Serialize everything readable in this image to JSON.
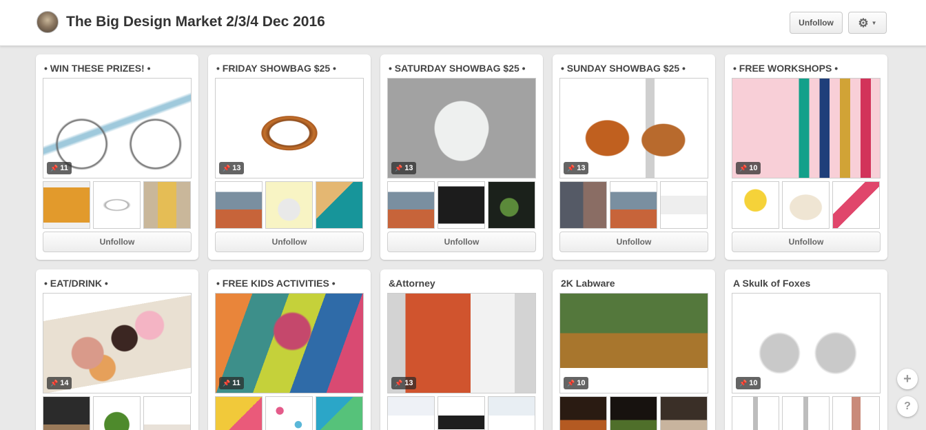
{
  "header": {
    "title": "The Big Design Market 2/3/4 Dec 2016",
    "unfollow_label": "Unfollow"
  },
  "row1": [
    {
      "title": "• WIN THESE PRIZES! •",
      "pins": "11",
      "unfollow_label": "Unfollow",
      "cover_bg": "radial-gradient(ellipse 22% 32% at 26% 66%, transparent 72%, #666 76%, transparent 82%), radial-gradient(ellipse 22% 32% at 76% 66%, transparent 72%, #666 76%, transparent 82%), linear-gradient(160deg, transparent 44%, #9fc9dc 46%, #9fc9dc 49%, transparent 51%), #ffffff",
      "thumbs": [
        "linear-gradient(#f0f0f0 0 12%, #e29a2c 12% 88%, #f0f0f0 88%)",
        "radial-gradient(ellipse 40% 18% at 50% 50%, #ffffff 55%, #a9a9a9 62%, #ffffff 76%), #ffffff",
        "linear-gradient(90deg, #c9b79a 0 30%, #e5bd55 30% 70%, #c9b79a 70%)"
      ]
    },
    {
      "title": "• FRIDAY SHOWBAG $25 •",
      "pins": "13",
      "unfollow_label": "Unfollow",
      "cover_bg": "radial-gradient(ellipse 24% 22% at 50% 55%, #ffffff 55%, #8b4a1c 58%, #c4712c 70%, #a8581f 78%, transparent 80%), #ffffff",
      "thumbs": [
        "linear-gradient(#ffffff 0 22%, #7a8fa0 22% 60%, #c7643a 60%)",
        "radial-gradient(circle at 50% 60%, #e9e9e9 0 30%, transparent 32%), #f8f4c4",
        "linear-gradient(135deg, #e4b772 0 40%, #17959a 40%)"
      ]
    },
    {
      "title": "• SATURDAY SHOWBAG $25 •",
      "pins": "13",
      "unfollow_label": "Unfollow",
      "cover_bg": "radial-gradient(circle at 50% 50%, #eef0ef 0 30%, transparent 31%), radial-gradient(circle at 50% 58%, #eef0ef 0 26%, transparent 27%), #a2a2a2",
      "thumbs": [
        "linear-gradient(#ffffff 0 22%, #7a8fa0 22% 60%, #c7643a 60%)",
        "linear-gradient(#ffffff 0 10%, #1c1c1c 10% 90%, #ffffff 90%)",
        "radial-gradient(circle at 45% 55%, #5b8a3a 0 25%, transparent 27%), #1b211b"
      ]
    },
    {
      "title": "• SUNDAY SHOWBAG $25 •",
      "pins": "13",
      "unfollow_label": "Unfollow",
      "cover_bg": "radial-gradient(ellipse 18% 22% at 32% 60%, #c0601f 80%, transparent 84%), radial-gradient(ellipse 18% 20% at 70% 62%, #b86a2d 80%, transparent 84%), linear-gradient(90deg, transparent 58%, #cfcfcf 58% 64%, transparent 64%), #ffffff",
      "thumbs": [
        "linear-gradient(90deg, #555a66 0 50%, #8a6d64 50%)",
        "linear-gradient(#ffffff 0 22%, #7a8fa0 22% 60%, #c7643a 60%)",
        "linear-gradient(#ffffff 0 30%, #eeeeee 30% 70%, #ffffff 70%)"
      ]
    },
    {
      "title": "• FREE WORKSHOPS •",
      "pins": "10",
      "unfollow_label": "Unfollow",
      "cover_bg": "linear-gradient(90deg, transparent 45%, #12a08a 45% 52%, transparent 52% 59%, #1f3f7a 59% 66%, transparent 66% 73%, #d1a336 73% 80%, transparent 80% 87%, #d2335a 87% 94%, transparent 94%), linear-gradient(#f8cfd7 0 58%, #f8cfd7 58%)",
      "thumbs": [
        "radial-gradient(circle at 50% 40%, #f5d239 0 30%, transparent 32%), #ffffff",
        "radial-gradient(ellipse 38% 30% at 50% 55%, #efe5d3 90%, transparent 94%), #ffffff",
        "linear-gradient(135deg, #ffffff 0 35%, #e0466b 35% 55%, #ffffff 55%)"
      ]
    }
  ],
  "row2": [
    {
      "title": "• EAT/DRINK •",
      "pins": "14",
      "cover_bg": "radial-gradient(circle at 30% 60%, #d99a8a 0 13%, transparent 14%), radial-gradient(circle at 55% 45%, #3b2622 0 13%, transparent 14%), radial-gradient(circle at 72% 32%, #f4b4c4 0 11%, transparent 12%), radial-gradient(circle at 40% 75%, #e6a05a 0 11%, transparent 12%), linear-gradient(170deg, #ffffff 0 22%, #e9e0d2 22% 80%, #ffffff 80%)",
      "thumbs": [
        "linear-gradient(#2b2b2b 0 60%, #9a7a5a 60%)",
        "radial-gradient(circle at 50% 60%, #4e8a2c 0 34%, transparent 36%), #ffffff",
        "linear-gradient(#ffffff 0 60%, #e8e1d8 60%)"
      ]
    },
    {
      "title": "• FREE KIDS ACTIVITIES •",
      "pins": "11",
      "cover_bg": "radial-gradient(circle at 52% 38%, #c5486c 0 18%, transparent 20%), linear-gradient(110deg, #e9853a 0 20%, #3d8f8a 20% 40%, #c5d13a 40% 60%, #2f6ba8 60% 80%, #d94a72 80%)",
      "thumbs": [
        "linear-gradient(135deg, #f1c93a 0 50%, #ea5a7a 50%)",
        "radial-gradient(circle at 30% 30%, #e45b8a 0 8%, transparent 9%), radial-gradient(circle at 70% 60%, #5ab7d8 0 8%, transparent 9%), #ffffff",
        "linear-gradient(135deg, #2ba6c8 0 40%, #56c27a 40%)"
      ]
    },
    {
      "title": "&Attorney",
      "pins": "13",
      "cover_bg": "linear-gradient(90deg, transparent 12%, #d0542e 12% 56%, #f2f2f2 56% 86%, transparent 86%), #d3d3d3",
      "thumbs": [
        "linear-gradient(#eef1f6 0 40%, #ffffff 40%)",
        "linear-gradient(#ffffff 0 40%, #1e1e1e 40% 70%, #ffffff 70%)",
        "linear-gradient(#e8eef3 0 40%, #ffffff 40%)"
      ]
    },
    {
      "title": "2K Labware",
      "pins": "10",
      "cover_bg": "linear-gradient(#54783c 0 40%, #a8762d 40% 75%, #ffffff 75%)",
      "thumbs": [
        "linear-gradient(#2a1b12 0 50%, #b45a22 50%)",
        "linear-gradient(#17120f 0 50%, #4f6f2a 50%)",
        "linear-gradient(#3a2f27 0 50%, #c8b49e 50%)"
      ]
    },
    {
      "title": "A Skulk of Foxes",
      "pins": "10",
      "cover_bg": "radial-gradient(circle at 32% 60%, #c9c9c9 0 16%, transparent 18%), radial-gradient(circle at 70% 60%, #c9c9c9 0 16%, transparent 18%), #ffffff",
      "thumbs": [
        "linear-gradient(90deg, #ffffff 0 45%, #bdbdbd 45% 55%, #ffffff 55%)",
        "linear-gradient(90deg, #ffffff 0 45%, #bdbdbd 45% 55%, #ffffff 55%)",
        "linear-gradient(90deg, #ffffff 0 40%, #c98a7a 40% 60%, #ffffff 60%)"
      ]
    }
  ],
  "float": {
    "plus_label": "+",
    "help_label": "?"
  }
}
